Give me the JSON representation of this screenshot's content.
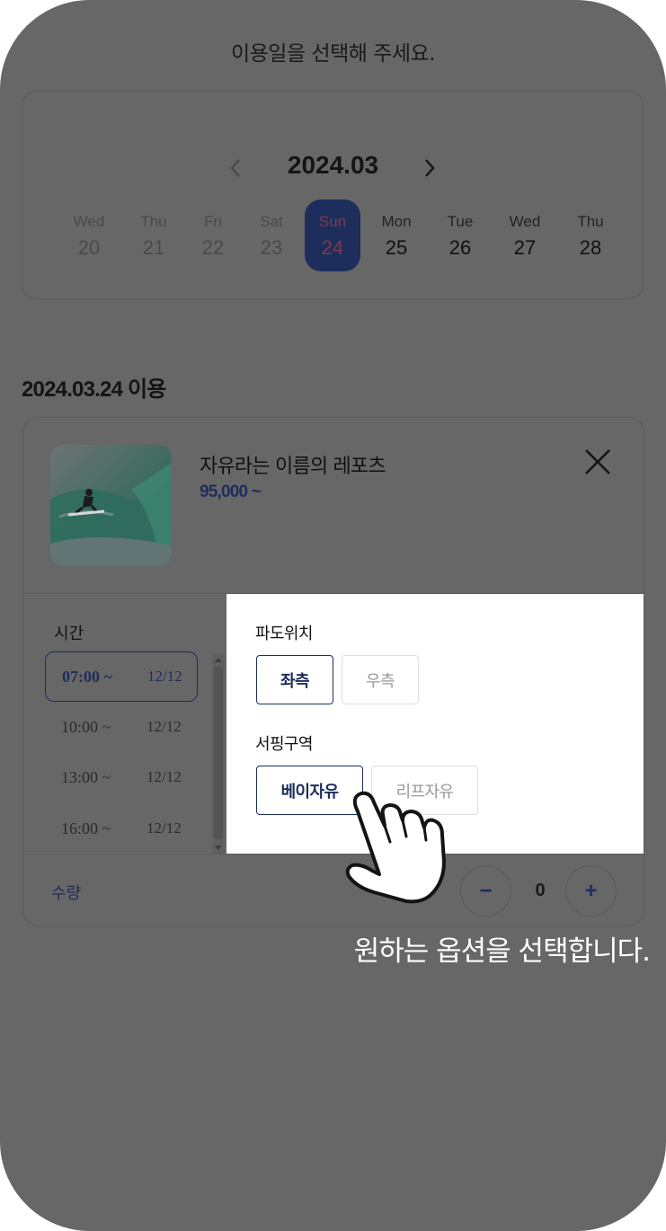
{
  "header": {
    "title": "이용일을 선택해 주세요."
  },
  "calendar": {
    "month": "2024.03",
    "days": [
      {
        "dow": "Wed",
        "date": "20",
        "state": "past"
      },
      {
        "dow": "Thu",
        "date": "21",
        "state": "past"
      },
      {
        "dow": "Fri",
        "date": "22",
        "state": "past"
      },
      {
        "dow": "Sat",
        "date": "23",
        "state": "past"
      },
      {
        "dow": "Sun",
        "date": "24",
        "state": "selected"
      },
      {
        "dow": "Mon",
        "date": "25",
        "state": "future"
      },
      {
        "dow": "Tue",
        "date": "26",
        "state": "future"
      },
      {
        "dow": "Wed",
        "date": "27",
        "state": "future"
      },
      {
        "dow": "Thu",
        "date": "28",
        "state": "future"
      }
    ]
  },
  "selection": {
    "date_heading": "2024.03.24 이용"
  },
  "product": {
    "name": "자유라는 이름의 레포츠",
    "price": "95,000 ~",
    "image_icon": "surfer-photo"
  },
  "times": {
    "label": "시간",
    "slots": [
      {
        "time": "07:00 ~",
        "qty": "12/12",
        "active": true
      },
      {
        "time": "10:00 ~",
        "qty": "12/12",
        "active": false
      },
      {
        "time": "13:00 ~",
        "qty": "12/12",
        "active": false
      },
      {
        "time": "16:00 ~",
        "qty": "12/12",
        "active": false
      }
    ]
  },
  "options": {
    "groups": [
      {
        "title": "파도위치",
        "choices": [
          {
            "label": "좌측",
            "selected": true
          },
          {
            "label": "우측",
            "selected": false
          }
        ]
      },
      {
        "title": "서핑구역",
        "choices": [
          {
            "label": "베이자유",
            "selected": true
          },
          {
            "label": "리프자유",
            "selected": false
          }
        ]
      }
    ]
  },
  "quantity": {
    "label": "수량",
    "value": "0",
    "minus": "−",
    "plus": "+"
  },
  "guide": {
    "text": "원하는 옵션을 선택합니다."
  },
  "colors": {
    "overlay": "#676767",
    "accent": "#1d2e5c",
    "selected_day_text": "#7d3a4a",
    "panel": "#ffffff"
  }
}
